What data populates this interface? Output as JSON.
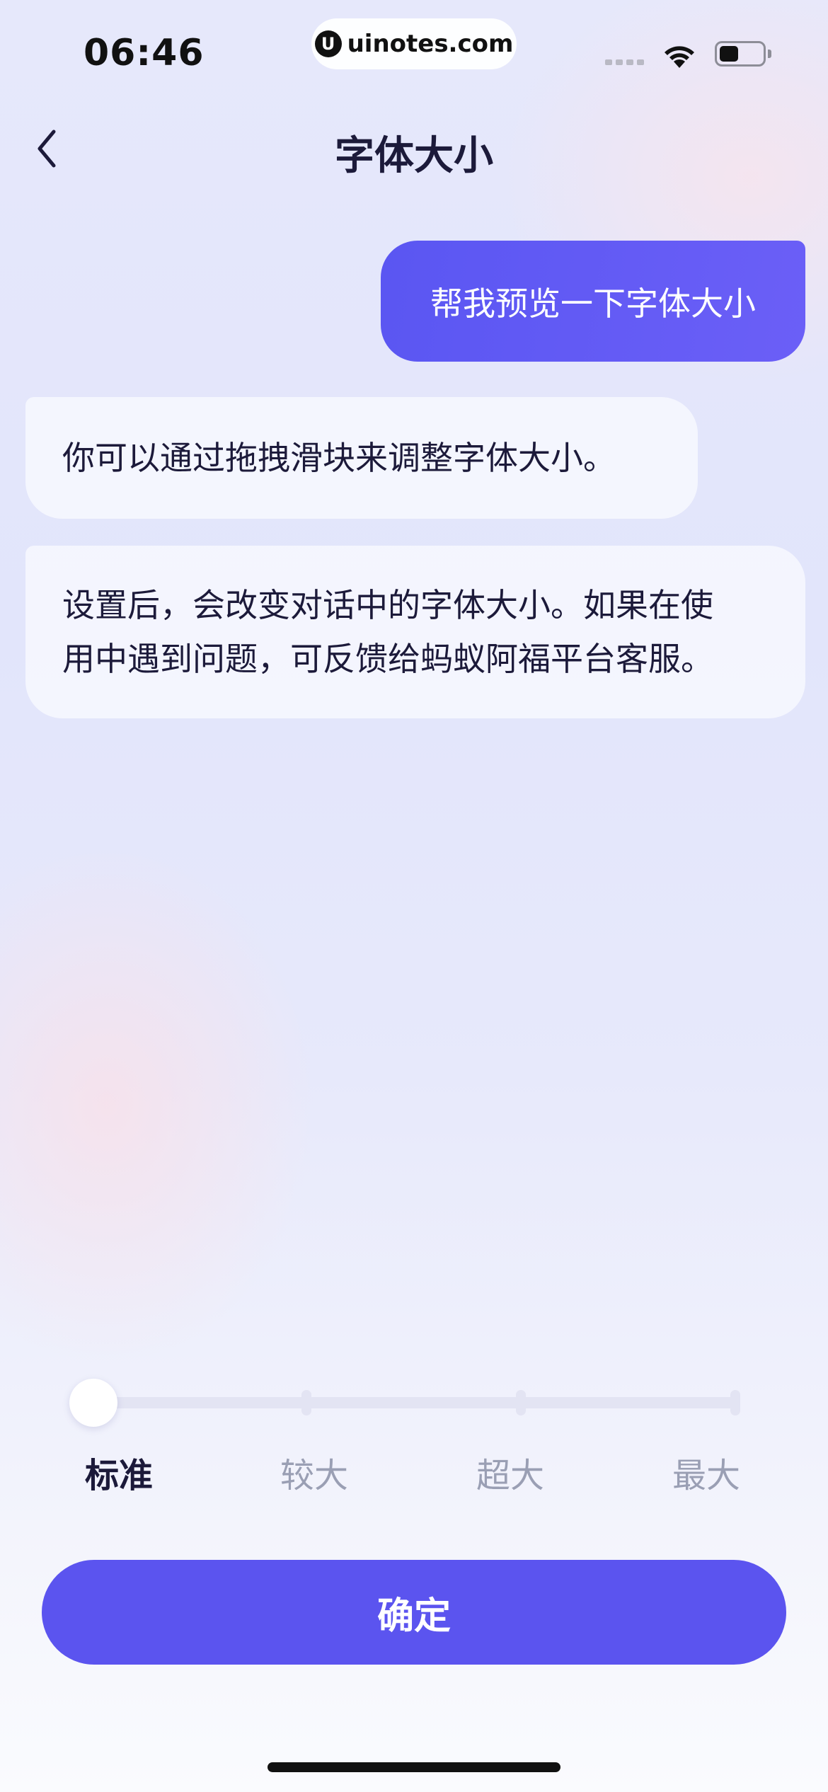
{
  "status_bar": {
    "time": "06:46",
    "watermark": "uinotes.com",
    "watermark_logo": "U"
  },
  "header": {
    "title": "字体大小",
    "back_icon": "chevron-left-icon"
  },
  "chat": {
    "user_message": "帮我预览一下字体大小",
    "bot_message_1": "你可以通过拖拽滑块来调整字体大小。",
    "bot_message_2_line_1": "设置后，会改变对话中的字体大小。如果在使",
    "bot_message_2_line_2": "用中遇到问题，可反馈给蚂蚁阿福平台客服。"
  },
  "font_size_slider": {
    "levels": [
      "标准",
      "较大",
      "超大",
      "最大"
    ],
    "selected_index": 0
  },
  "confirm_button": {
    "label": "确定"
  },
  "colors": {
    "accent": "#5b54ef",
    "user_bubble": "#5f59f4",
    "text_primary": "#1c1a3a",
    "text_muted": "#9a9fb4"
  }
}
